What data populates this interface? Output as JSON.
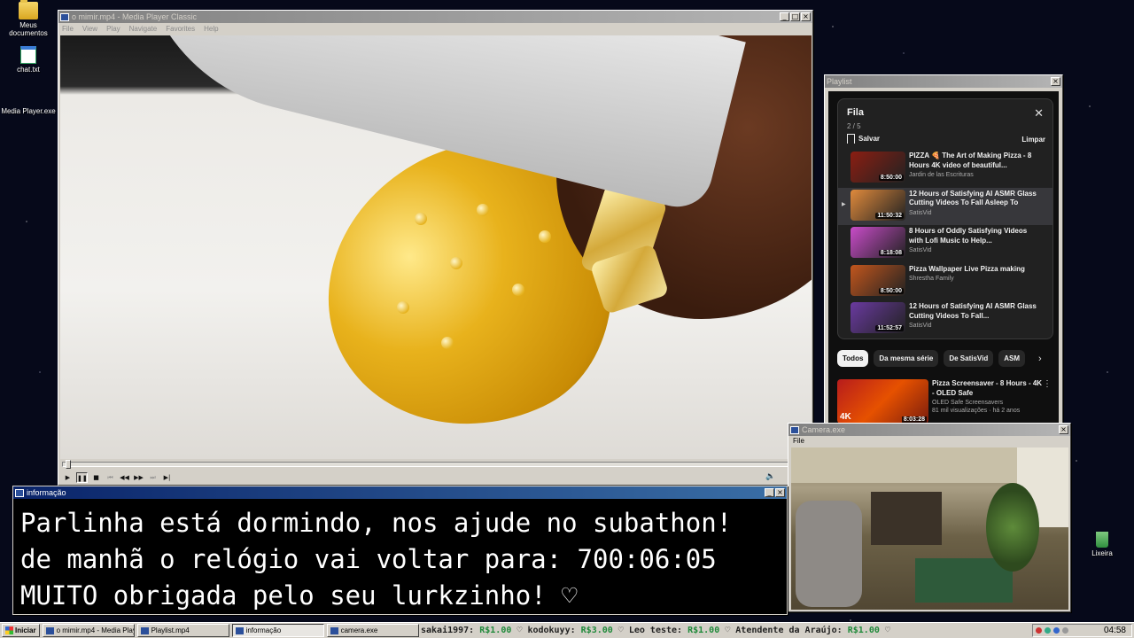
{
  "desktop": {
    "icons": [
      {
        "label": "Meus documentos"
      },
      {
        "label": "chat.txt"
      },
      {
        "label": "Media Player.exe"
      },
      {
        "label": "Lixeira"
      }
    ]
  },
  "player": {
    "title": "o mimir.mp4 - Media Player Classic",
    "menu": [
      "File",
      "View",
      "Play",
      "Navigate",
      "Favorites",
      "Help"
    ],
    "seek_position_fraction": 0.004,
    "controls": {
      "play": "▶",
      "pause": "❚❚",
      "stop": "■",
      "prev": "⏮",
      "rew": "◀◀",
      "fwd": "▶▶",
      "next": "⏭",
      "step": "▶|"
    },
    "volume_icon": "🔈"
  },
  "playlist": {
    "window_title": "Playlist",
    "queue_title": "Fila",
    "queue_count": "2 / 5",
    "save_label": "Salvar",
    "clear_label": "Limpar",
    "items": [
      {
        "title": "PIZZA 🍕 The Art of Making Pizza - 8 Hours 4K video of beautiful...",
        "channel": "Jardin de las Escrituras",
        "duration": "8:50:00",
        "thumb_color": "#8b1e12",
        "current": false
      },
      {
        "title": "12 Hours of Satisfying AI ASMR Glass Cutting Videos To Fall Asleep To",
        "channel": "SatisVid",
        "duration": "11:50:32",
        "thumb_color": "#e08a3c",
        "current": true
      },
      {
        "title": "8 Hours of Oddly Satisfying Videos with Lofi Music to Help...",
        "channel": "SatisVid",
        "duration": "8:18:08",
        "thumb_color": "#c94cc9",
        "current": false
      },
      {
        "title": "Pizza Wallpaper Live Pizza making",
        "channel": "Shrestha Family",
        "duration": "8:50:00",
        "thumb_color": "#c2561d",
        "current": false
      },
      {
        "title": "12 Hours of Satisfying AI ASMR Glass Cutting Videos To Fall...",
        "channel": "SatisVid",
        "duration": "11:52:57",
        "thumb_color": "#6a3aa0",
        "current": false
      }
    ],
    "chips": [
      "Todos",
      "Da mesma série",
      "De SatisVid",
      "ASM"
    ],
    "recommended": {
      "title": "Pizza Screensaver - 8 Hours - 4K - OLED Safe",
      "channel": "OLED Safe Screensavers",
      "stats": "81 mil visualizações · há 2 anos",
      "duration": "8:03:28",
      "badge": "4K"
    }
  },
  "camera": {
    "title": "Camera.exe",
    "menu": "File"
  },
  "info": {
    "title": "informação",
    "lines": [
      "Parlinha está dormindo, nos ajude no subathon!",
      "de manhã o relógio vai voltar para:  700:06:05",
      "MUITO obrigada pelo seu lurkzinho! ♡"
    ]
  },
  "taskbar": {
    "start": "Iniciar",
    "tasks": [
      {
        "label": "o mimir.mp4 - Media Player...",
        "active": false
      },
      {
        "label": "Playlist.mp4",
        "active": false
      },
      {
        "label": "informação",
        "active": true
      },
      {
        "label": "camera.exe",
        "active": false
      }
    ],
    "ticker": [
      {
        "name": "sakai1997:",
        "amount": "R$1.00"
      },
      {
        "name": "kodokuyy:",
        "amount": "R$3.00"
      },
      {
        "name": "Leo teste:",
        "amount": "R$1.00"
      },
      {
        "name": "Atendente da Araújo:",
        "amount": "R$1.00"
      }
    ],
    "clock": "04:58"
  }
}
